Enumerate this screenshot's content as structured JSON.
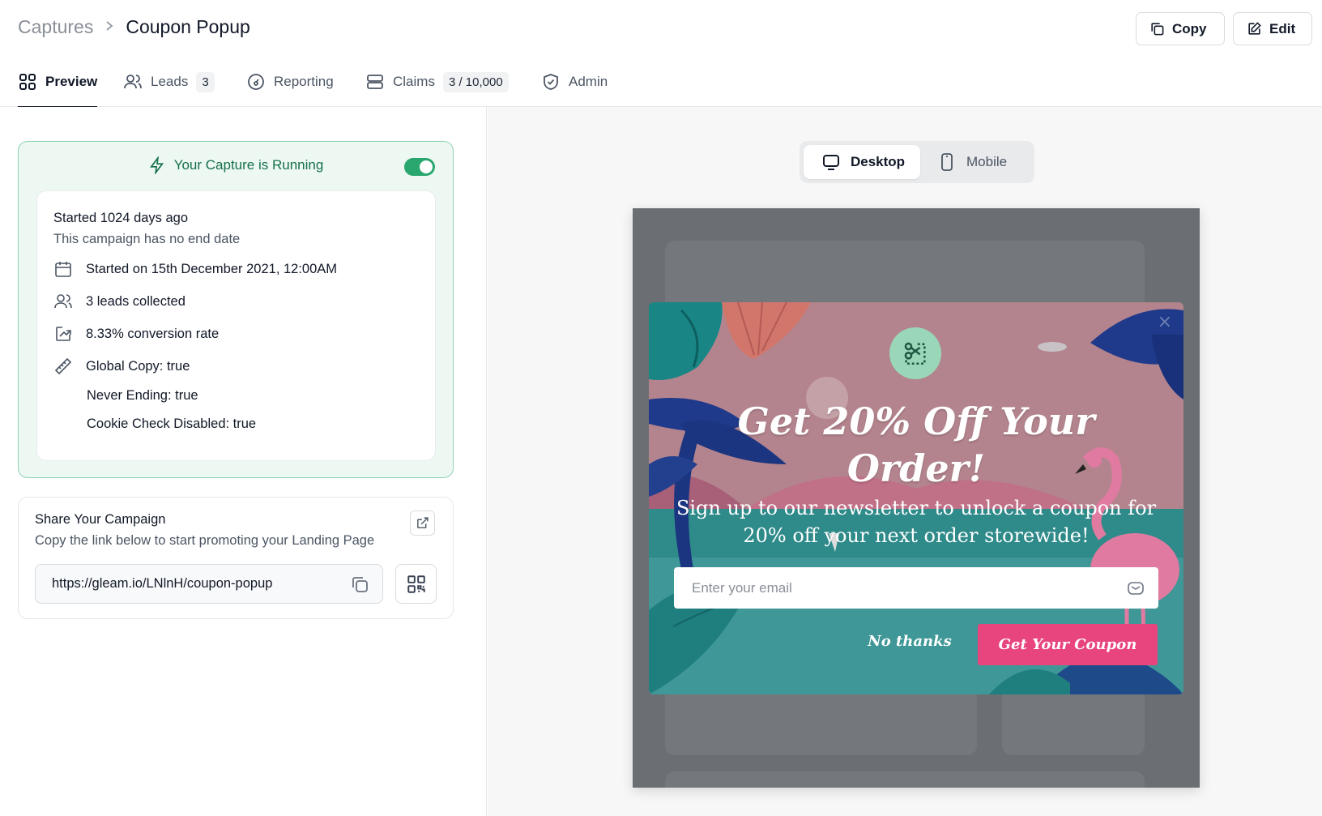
{
  "breadcrumb": {
    "root": "Captures",
    "separator": ">",
    "current": "Coupon Popup"
  },
  "header": {
    "copy_label": "Copy",
    "edit_label": "Edit"
  },
  "tabs": [
    {
      "label": "Preview",
      "icon": "grid-icon",
      "active": true
    },
    {
      "label": "Leads",
      "icon": "users-icon",
      "badge": "3"
    },
    {
      "label": "Reporting",
      "icon": "gauge-icon"
    },
    {
      "label": "Claims",
      "icon": "stack-icon",
      "badge": "3 / 10,000"
    },
    {
      "label": "Admin",
      "icon": "shield-icon"
    }
  ],
  "status": {
    "label": "Your Capture is Running",
    "running": true,
    "started": "Started 1024 days ago",
    "end_note": "This campaign has no end date",
    "start_date": "Started on 15th December 2021, 12:00AM",
    "leads": "3 leads collected",
    "conversion": "8.33% conversion rate",
    "flags": [
      "Global Copy: true",
      "Never Ending: true",
      "Cookie Check Disabled: true"
    ]
  },
  "share": {
    "title": "Share Your Campaign",
    "subtitle": "Copy the link below to start promoting your Landing Page",
    "url": "https://gleam.io/LNlnH/coupon-popup"
  },
  "device": {
    "desktop_label": "Desktop",
    "mobile_label": "Mobile",
    "selected": "Desktop"
  },
  "popup": {
    "title_line1": "Get 20% Off Your",
    "title_line2": "Order!",
    "subtitle_line1": "Sign up to our newsletter to unlock a coupon for",
    "subtitle_line2": "20% off your next order storewide!",
    "email_placeholder": "Enter your email",
    "decline_label": "No thanks",
    "cta_label": "Get Your Coupon",
    "close_glyph": "×"
  },
  "colors": {
    "accent_green": "#2aa76f",
    "cta_pink": "#e8457f",
    "popup_bg": "#b3848d"
  }
}
